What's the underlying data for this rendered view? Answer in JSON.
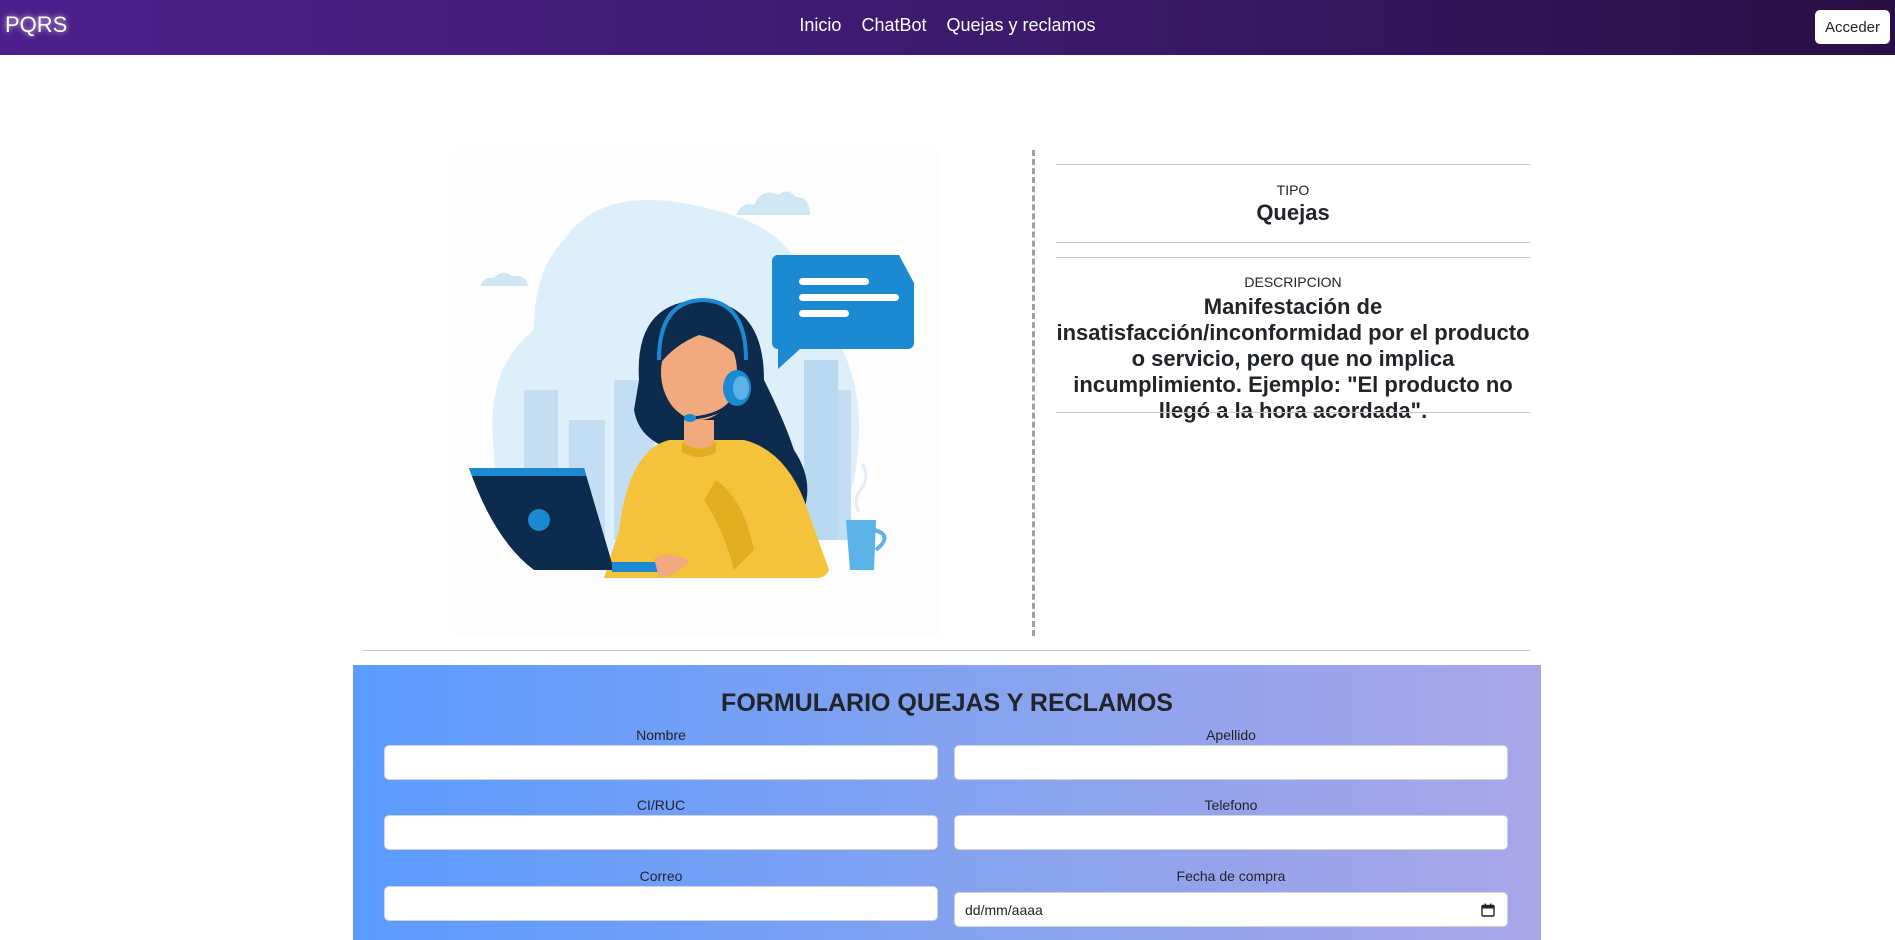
{
  "nav": {
    "brand": "PQRS",
    "links": [
      "Inicio",
      "ChatBot",
      "Quejas y reclamos"
    ],
    "login_label": "Acceder"
  },
  "info": {
    "tipo_label": "TIPO",
    "tipo_value": "Quejas",
    "desc_label": "DESCRIPCION",
    "desc_value": "Manifestación de insatisfacción/inconformidad por el producto o servicio, pero que no implica incumplimiento. Ejemplo: \"El producto no llegó a la hora acordada\"."
  },
  "form": {
    "title": "FORMULARIO QUEJAS Y RECLAMOS",
    "fields": [
      {
        "label": "Nombre",
        "value": ""
      },
      {
        "label": "Apellido",
        "value": ""
      },
      {
        "label": "CI/RUC",
        "value": ""
      },
      {
        "label": "Telefono",
        "value": ""
      },
      {
        "label": "Correo",
        "value": ""
      },
      {
        "label": "Fecha de compra",
        "value": "dd/mm/aaaa"
      }
    ]
  },
  "colors": {
    "navbar": "#4e1f8c",
    "form_start": "#5b9bff",
    "form_end": "#a9a6e8",
    "illustration_accent": "#f5c33b"
  },
  "icons": [
    "chat-bubble-icon",
    "headset-icon",
    "laptop-icon",
    "mug-icon",
    "calendar-icon"
  ]
}
